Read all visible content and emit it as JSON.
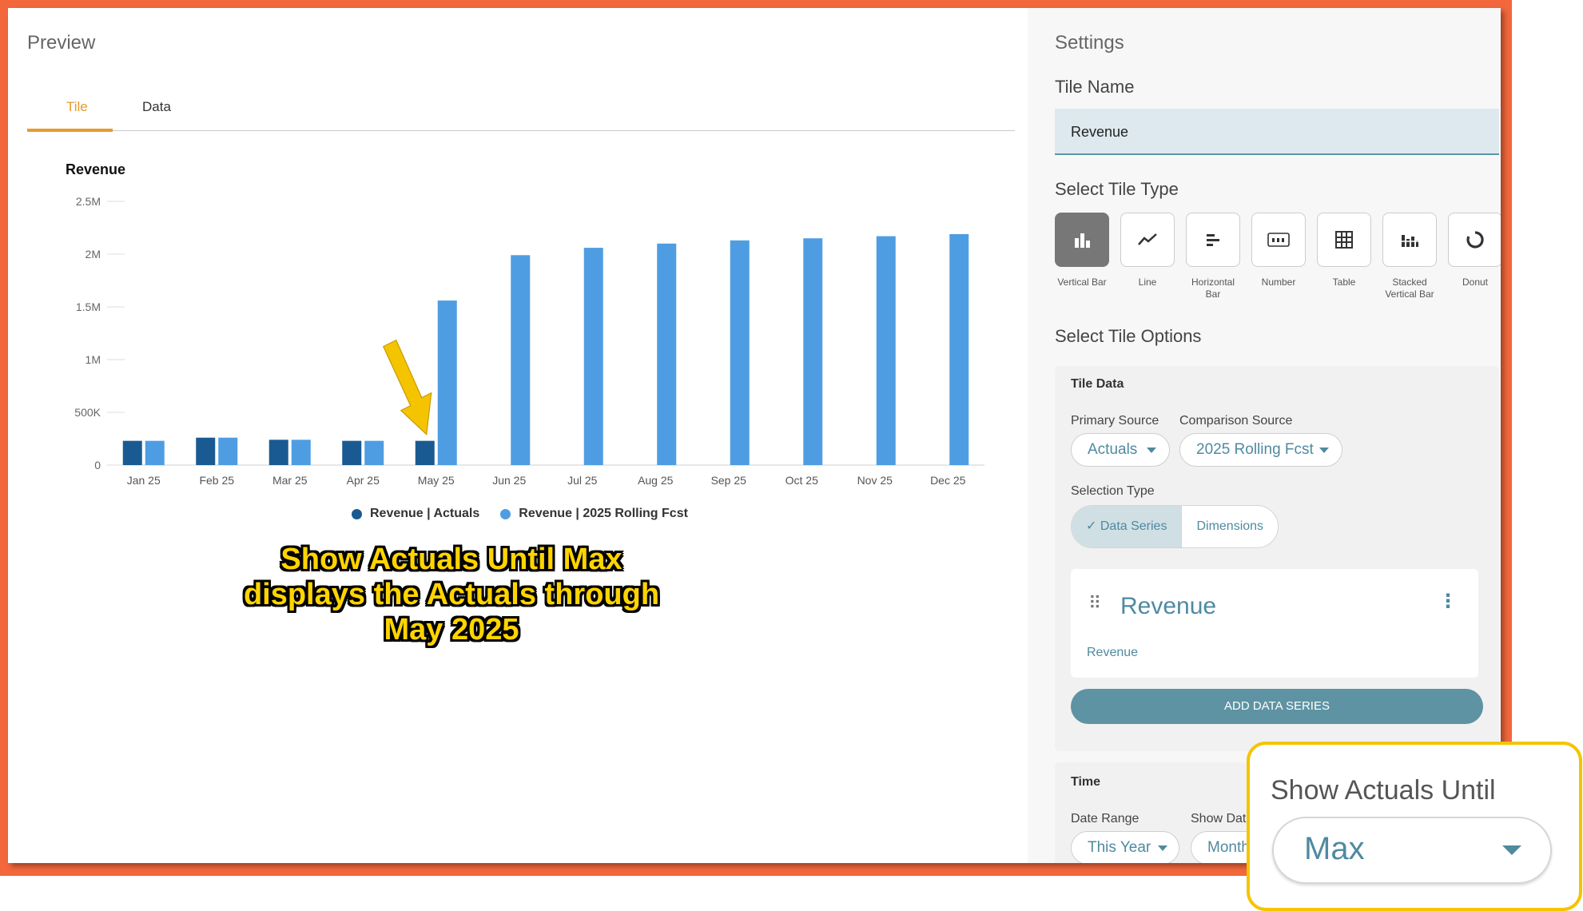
{
  "preview": {
    "title": "Preview",
    "tabs": [
      {
        "label": "Tile",
        "active": true
      },
      {
        "label": "Data",
        "active": false
      }
    ]
  },
  "chart_data": {
    "type": "bar",
    "title": "Revenue",
    "categories": [
      "Jan 25",
      "Feb 25",
      "Mar 25",
      "Apr 25",
      "May 25",
      "Jun 25",
      "Jul 25",
      "Aug 25",
      "Sep 25",
      "Oct 25",
      "Nov 25",
      "Dec 25"
    ],
    "series": [
      {
        "name": "Revenue | Actuals",
        "color": "#1a5a92",
        "values": [
          230000,
          260000,
          240000,
          230000,
          230000,
          0,
          0,
          0,
          0,
          0,
          0,
          0
        ]
      },
      {
        "name": "Revenue | 2025 Rolling Fcst",
        "color": "#4e9de3",
        "values": [
          230000,
          260000,
          240000,
          230000,
          1560000,
          1990000,
          2060000,
          2100000,
          2130000,
          2150000,
          2170000,
          2190000
        ]
      }
    ],
    "yticks": [
      "0",
      "500K",
      "1M",
      "1.5M",
      "2M",
      "2.5M"
    ],
    "ylim": [
      0,
      2500000
    ],
    "grid": false,
    "legend": "bottom"
  },
  "annotation": {
    "lines": [
      "Show Actuals Until Max",
      "displays the Actuals through",
      "May 2025"
    ],
    "arrow_color": "#f5c400"
  },
  "settings": {
    "title": "Settings",
    "tile_name_label": "Tile Name",
    "tile_name_value": "Revenue",
    "tile_type_label": "Select Tile Type",
    "tile_types": [
      {
        "label": "Vertical Bar",
        "icon": "vertical-bar-icon",
        "selected": true
      },
      {
        "label": "Line",
        "icon": "line-chart-icon",
        "selected": false
      },
      {
        "label": "Horizontal Bar",
        "icon": "horizontal-bar-icon",
        "selected": false
      },
      {
        "label": "Number",
        "icon": "number-icon",
        "selected": false
      },
      {
        "label": "Table",
        "icon": "table-icon",
        "selected": false
      },
      {
        "label": "Stacked Vertical Bar",
        "icon": "stacked-bar-icon",
        "selected": false
      },
      {
        "label": "Donut",
        "icon": "donut-icon",
        "selected": false
      }
    ],
    "tile_options_label": "Select Tile Options",
    "tile_data": {
      "heading": "Tile Data",
      "primary_source_label": "Primary Source",
      "primary_source_value": "Actuals",
      "comparison_source_label": "Comparison Source",
      "comparison_source_value": "2025 Rolling Fcst",
      "selection_type_label": "Selection Type",
      "selection_options": [
        "Data Series",
        "Dimensions"
      ],
      "series_name": "Revenue",
      "series_sub": "Revenue",
      "add_button": "ADD DATA SERIES"
    },
    "time": {
      "heading": "Time",
      "date_range_label": "Date Range",
      "date_range_value": "This Year",
      "show_data_label": "Show Dat",
      "show_data_value": "Month"
    }
  },
  "zoom_box": {
    "label": "Show Actuals Until",
    "value": "Max",
    "border_color": "#f5c400"
  },
  "colors": {
    "frame": "#f2673c",
    "accent_tab": "#e89a2c",
    "teal": "#4f8aa0"
  }
}
